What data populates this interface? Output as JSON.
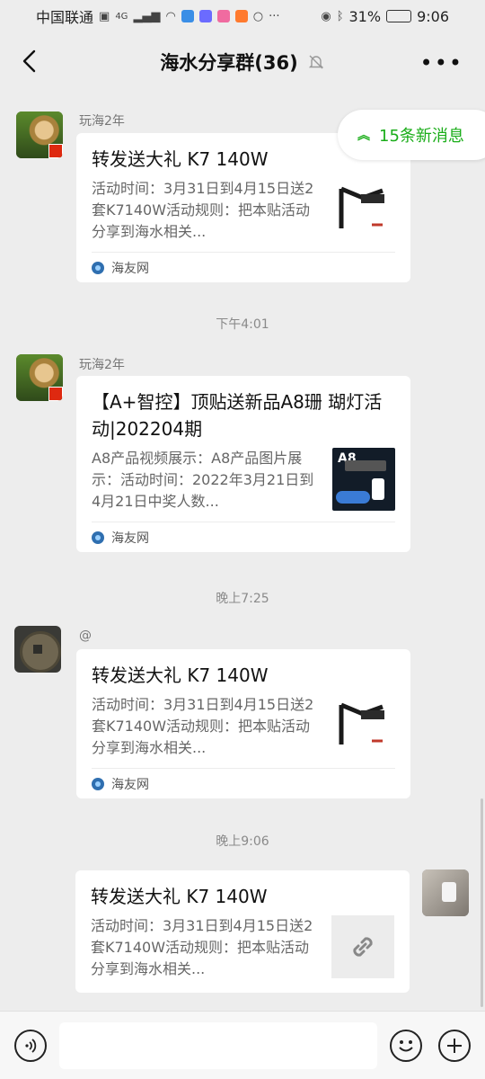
{
  "status_bar": {
    "carrier": "中国联通",
    "network": "4G",
    "battery": "31%",
    "time": "9:06",
    "more": "···"
  },
  "nav": {
    "title": "海水分享群(36)"
  },
  "new_messages": {
    "label": "15条新消息"
  },
  "messages": [
    {
      "sender": "玩海2年",
      "title": "转发送大礼 K7 140W",
      "desc": "活动时间：3月31日到4月15日送2套K7140W活动规则：把本贴活动分享到海水相关...",
      "source": "海友网"
    },
    {
      "timestamp": "下午4:01",
      "sender": "玩海2年",
      "title": "【A+智控】顶贴送新品A8珊 瑚灯活动|202204期",
      "desc": "A8产品视频展示：A8产品图片展示：活动时间：2022年3月21日到4月21日中奖人数...",
      "source": "海友网",
      "thumb_text": "A8"
    },
    {
      "timestamp": "晚上7:25",
      "sender": "@",
      "title": "转发送大礼 K7 140W",
      "desc": "活动时间：3月31日到4月15日送2套K7140W活动规则：把本贴活动分享到海水相关...",
      "source": "海友网"
    },
    {
      "timestamp": "晚上9:06",
      "title": "转发送大礼 K7 140W",
      "desc": "活动时间：3月31日到4月15日送2套K7140W活动规则：把本贴活动分享到海水相关..."
    }
  ],
  "input": {
    "placeholder": ""
  },
  "colors": {
    "accent_green": "#1aad19",
    "background": "#ededed"
  }
}
